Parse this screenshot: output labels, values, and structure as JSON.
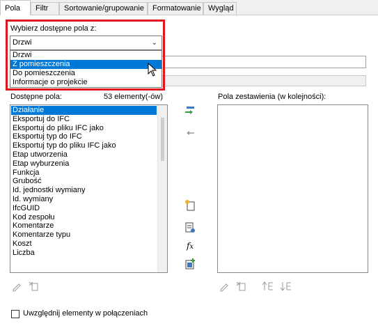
{
  "tabs": [
    {
      "label": "Pola",
      "active": true
    },
    {
      "label": "Filtr",
      "active": false
    },
    {
      "label": "Sortowanie/grupowanie",
      "active": false
    },
    {
      "label": "Formatowanie",
      "active": false
    },
    {
      "label": "Wygląd",
      "active": false
    }
  ],
  "fields_source": {
    "label": "Wybierz dostępne pola z:",
    "selected": "Drzwi",
    "options": [
      "Drzwi",
      "Z pomieszczenia",
      "Do pomieszczenia",
      "Informacje o projekcie"
    ],
    "highlighted": "Z pomieszczenia",
    "highlight_color": "#e0161e"
  },
  "available": {
    "label": "Dostępne pola:",
    "count": "53 elementy(-ów)",
    "items": [
      "Działanie",
      "Eksportuj do IFC",
      "Eksportuj do pliku IFC jako",
      "Eksportuj typ do IFC",
      "Eksportuj typ do pliku IFC jako",
      "Etap utworzenia",
      "Etap wyburzenia",
      "Funkcja",
      "Grubość",
      "Id. jednostki wymiany",
      "Id. wymiany",
      "IfcGUID",
      "Kod zespołu",
      "Komentarze",
      "Komentarze typu",
      "Koszt",
      "Liczba"
    ],
    "selected_index": 0
  },
  "scheduled": {
    "label": "Pola zestawienia (w kolejności):",
    "items": []
  },
  "include_linked": {
    "label": "Uwzględnij elementy w połączeniach",
    "checked": false
  },
  "icons": {
    "add": "add-parameter-icon",
    "remove": "remove-parameter-icon",
    "new_param": "new-parameter-icon",
    "combine": "combine-parameters-icon",
    "calc": "calculated-value-icon",
    "add_edit_link": "add-to-schedule-icon",
    "edit": "edit-pencil-icon",
    "delete": "delete-icon",
    "move_up": "move-up-icon",
    "move_down": "move-down-icon"
  },
  "colors": {
    "accent": "#0078d7",
    "highlight_box": "#e0161e",
    "add_arrow": "#3a9a3a"
  }
}
